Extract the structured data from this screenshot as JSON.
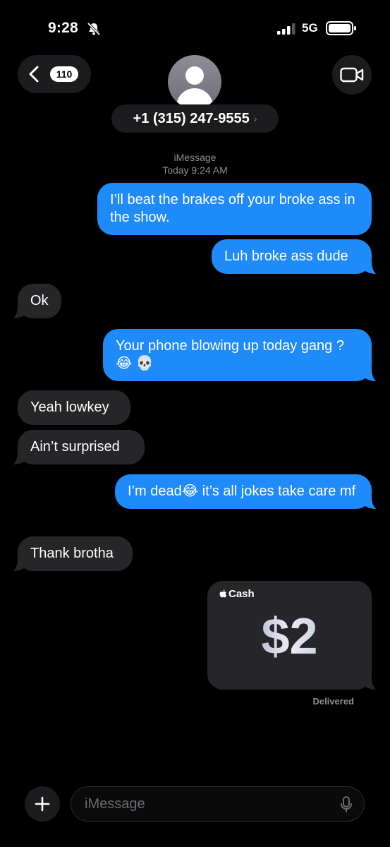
{
  "status_bar": {
    "time": "9:28",
    "network": "5G"
  },
  "header": {
    "back_count": "110",
    "contact_number": "+1 (315) 247-9555",
    "contact_chevron": "›"
  },
  "thread_meta": {
    "service": "iMessage",
    "timestamp": "Today 9:24 AM"
  },
  "messages": [
    {
      "direction": "outgoing",
      "text": "I’ll beat the brakes off your broke ass in the show."
    },
    {
      "direction": "outgoing",
      "text": "Luh broke ass dude"
    },
    {
      "direction": "incoming",
      "text": "Ok"
    },
    {
      "direction": "outgoing",
      "text": "Your phone blowing up today gang ? 😂 💀"
    },
    {
      "direction": "incoming",
      "text": "Yeah lowkey"
    },
    {
      "direction": "incoming",
      "text": "Ain’t surprised"
    },
    {
      "direction": "outgoing",
      "text": "I’m dead😂  it’s all jokes take care mf"
    },
    {
      "direction": "incoming",
      "text": "Thank brotha"
    }
  ],
  "cash": {
    "brand": "Cash",
    "amount": "$2"
  },
  "delivery_status": "Delivered",
  "composer": {
    "placeholder": "iMessage"
  },
  "icons": {
    "back": "chevron-left-icon",
    "bell": "bell-slash-icon",
    "video": "video-camera-icon",
    "plus": "plus-icon",
    "mic": "microphone-icon",
    "apple": "apple-logo-icon"
  },
  "colors": {
    "outgoing_bubble": "#1f8af9",
    "incoming_bubble": "#262628",
    "background": "#000000"
  }
}
